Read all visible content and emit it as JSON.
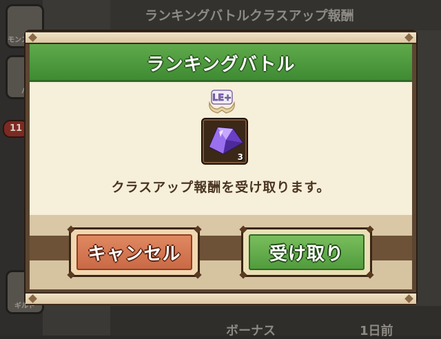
{
  "background": {
    "header_title": "ランキングバトルクラスアップ報酬",
    "sidebar": [
      "モンスター",
      "パ",
      "ギルド"
    ],
    "badge": "11",
    "footer_left": "ボーナス",
    "footer_right": "1日前"
  },
  "dialog": {
    "title": "ランキングバトル",
    "rank_badge": "LE+",
    "reward": {
      "icon": "purple-crystal-icon",
      "count": "3"
    },
    "message": "クラスアップ報酬を受け取ります。",
    "cancel_label": "キャンセル",
    "accept_label": "受け取り"
  },
  "colors": {
    "title_green": "#4f9a3c",
    "cancel_orange": "#d0714c",
    "accept_green": "#5fa646",
    "panel_cream": "#f6efd9",
    "frame_brown": "#5b4531"
  }
}
